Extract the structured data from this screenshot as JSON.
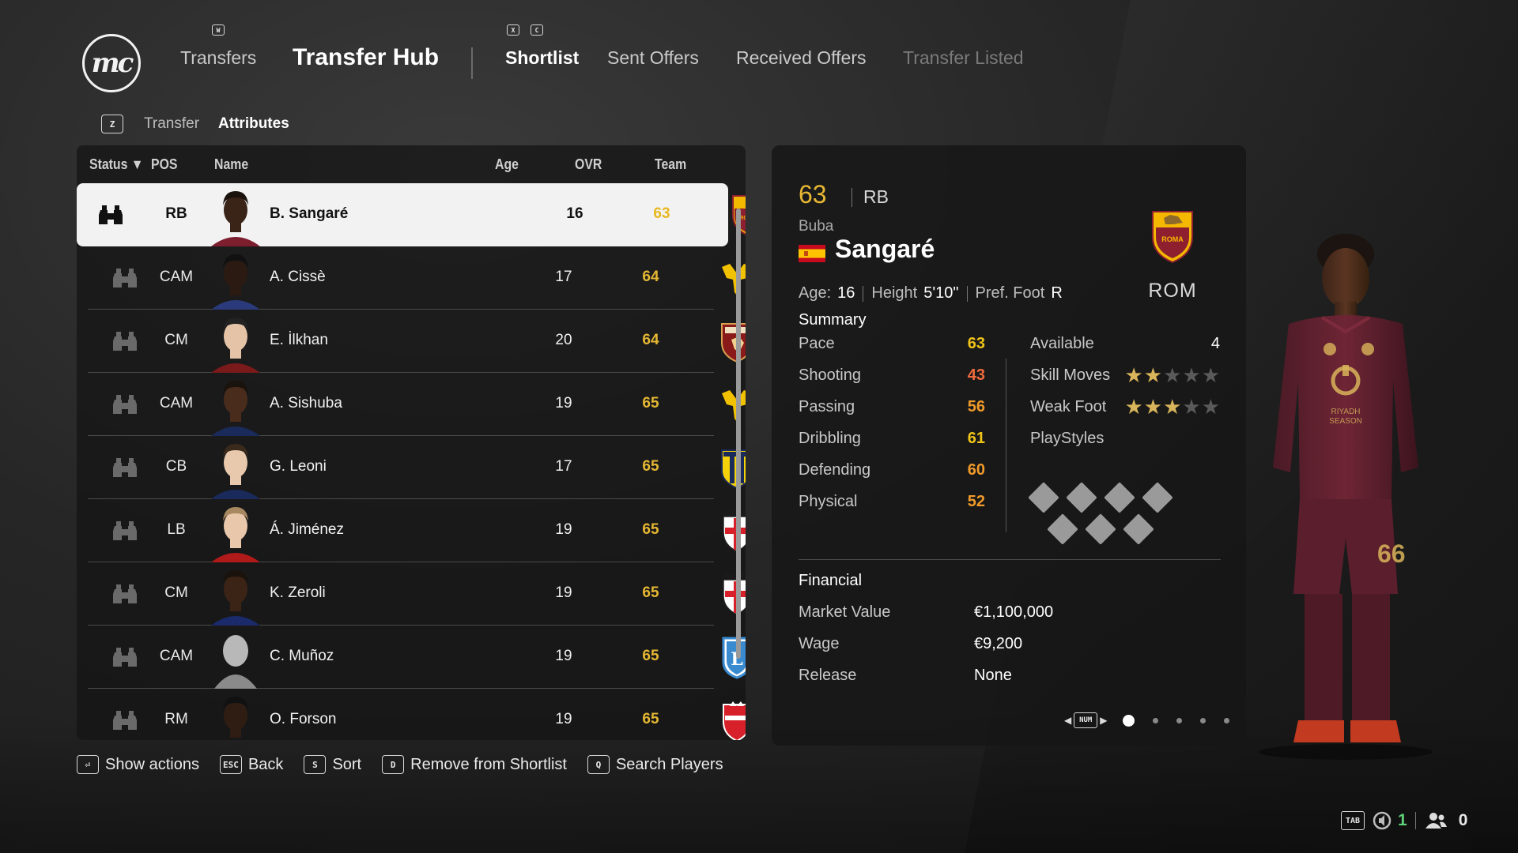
{
  "nav": {
    "logo": "mc",
    "transfers": "Transfers",
    "transfer_hub": "Transfer Hub",
    "shortlist": "Shortlist",
    "sent_offers": "Sent Offers",
    "received_offers": "Received Offers",
    "transfer_listed": "Transfer Listed",
    "key_w": "W",
    "key_x": "X",
    "key_c": "C"
  },
  "subnav": {
    "key": "Z",
    "transfer": "Transfer",
    "attributes": "Attributes"
  },
  "list": {
    "headers": {
      "status": "Status ▼",
      "pos": "POS",
      "name": "Name",
      "age": "Age",
      "ovr": "OVR",
      "team": "Team"
    },
    "rows": [
      {
        "pos": "RB",
        "name": "B. Sangaré",
        "age": "16",
        "ovr": "63",
        "team": "Roma",
        "selected": true
      },
      {
        "pos": "CAM",
        "name": "A. Cissè",
        "age": "17",
        "ovr": "64",
        "team": "Hellas Verona"
      },
      {
        "pos": "CM",
        "name": "E. İlkhan",
        "age": "20",
        "ovr": "64",
        "team": "Torino"
      },
      {
        "pos": "CAM",
        "name": "A. Sishuba",
        "age": "19",
        "ovr": "65",
        "team": "Hellas Verona"
      },
      {
        "pos": "CB",
        "name": "G. Leoni",
        "age": "17",
        "ovr": "65",
        "team": "Parma"
      },
      {
        "pos": "LB",
        "name": "Á. Jiménez",
        "age": "19",
        "ovr": "65",
        "team": "Milano FC"
      },
      {
        "pos": "CM",
        "name": "K. Zeroli",
        "age": "19",
        "ovr": "65",
        "team": "Milano FC"
      },
      {
        "pos": "CAM",
        "name": "C. Muñoz",
        "age": "19",
        "ovr": "65",
        "team": "Lecce"
      },
      {
        "pos": "RM",
        "name": "O. Forson",
        "age": "19",
        "ovr": "65",
        "team": "Monza"
      }
    ]
  },
  "hints": [
    {
      "key": "⏎",
      "label": "Show actions"
    },
    {
      "key": "ESC",
      "label": "Back"
    },
    {
      "key": "S",
      "label": "Sort"
    },
    {
      "key": "D",
      "label": "Remove from Shortlist"
    },
    {
      "key": "Q",
      "label": "Search Players"
    }
  ],
  "detail": {
    "ovr": "63",
    "pos": "RB",
    "first_name": "Buba",
    "last_name": "Sangaré",
    "age_label": "Age:",
    "age": "16",
    "height_label": "Height",
    "height": "5'10\"",
    "foot_label": "Pref. Foot",
    "foot": "R",
    "club": "ROM",
    "summary_title": "Summary",
    "attributes": [
      {
        "label": "Pace",
        "value": "63",
        "color": "#f0c419"
      },
      {
        "label": "Shooting",
        "value": "43",
        "color": "#f06a3c"
      },
      {
        "label": "Passing",
        "value": "56",
        "color": "#f09a2a"
      },
      {
        "label": "Dribbling",
        "value": "61",
        "color": "#f0c419"
      },
      {
        "label": "Defending",
        "value": "60",
        "color": "#f09a2a"
      },
      {
        "label": "Physical",
        "value": "52",
        "color": "#f09a2a"
      }
    ],
    "available_label": "Available",
    "available": "4",
    "skill_moves_label": "Skill Moves",
    "skill_moves": 2,
    "weak_foot_label": "Weak Foot",
    "weak_foot": 3,
    "star_max": 5,
    "playstyles_label": "PlayStyles",
    "financial_title": "Financial",
    "financial": [
      {
        "label": "Market Value",
        "value": "€1,100,000"
      },
      {
        "label": "Wage",
        "value": "€9,200"
      },
      {
        "label": "Release",
        "value": "None"
      }
    ],
    "pager_key": "NUM",
    "pages": 5,
    "current_page": 1
  },
  "bottom_right": {
    "key": "TAB",
    "count_green": "1",
    "count": "0"
  },
  "colors": {
    "ovr_gold": "#e5b733",
    "background": "#262626",
    "panel": "#161616",
    "selected_row": "#f2f2f2"
  }
}
